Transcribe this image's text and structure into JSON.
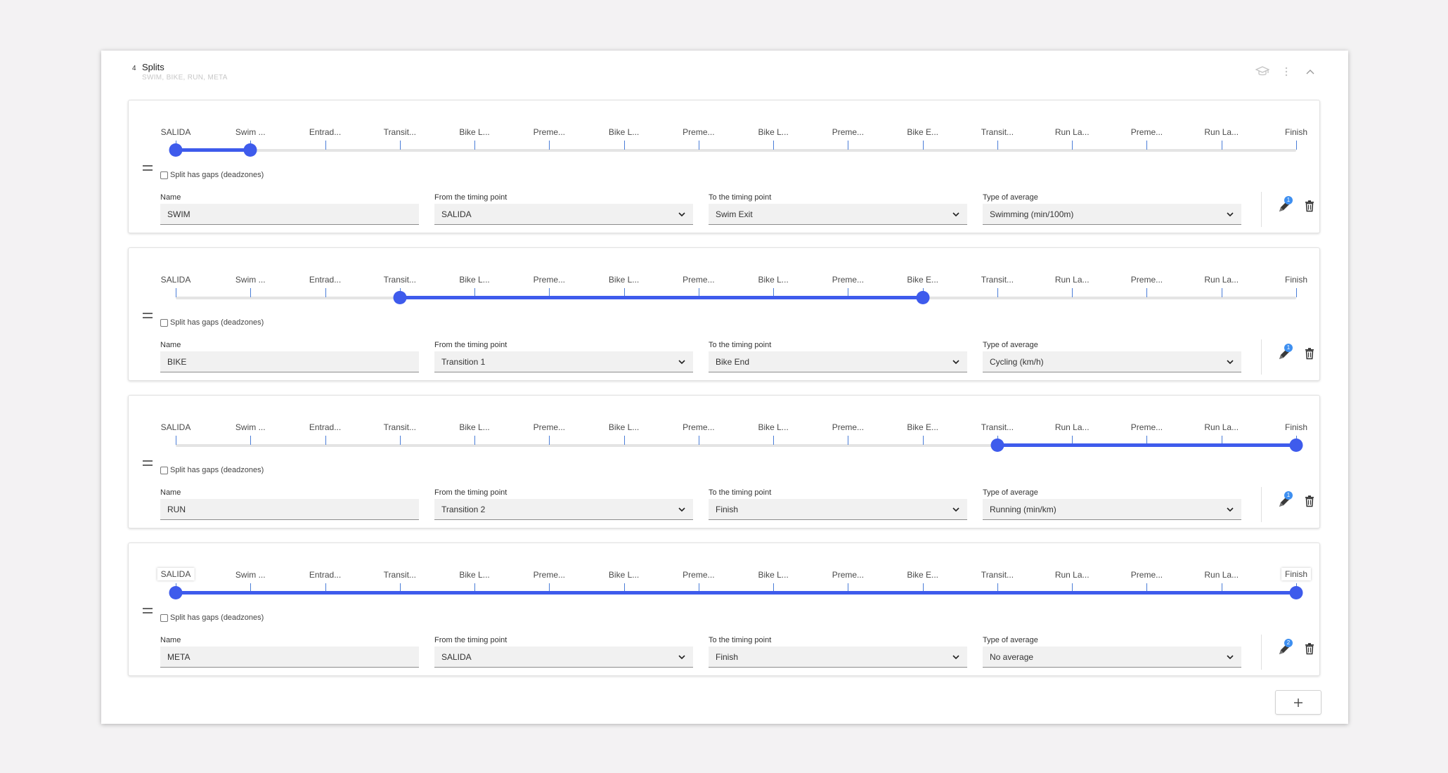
{
  "section": {
    "step_number": "4",
    "title": "Splits",
    "subtitle": "SWIM, BIKE, RUN, META"
  },
  "timing_points": [
    "SALIDA",
    "Swim ...",
    "Entrad...",
    "Transit...",
    "Bike L...",
    "Preme...",
    "Bike L...",
    "Preme...",
    "Bike L...",
    "Preme...",
    "Bike E...",
    "Transit...",
    "Run La...",
    "Preme...",
    "Run La...",
    "Finish"
  ],
  "labels": {
    "gaps": "Split has gaps (deadzones)",
    "name": "Name",
    "from": "From the timing point",
    "to": "To the timing point",
    "average": "Type of average"
  },
  "splits": [
    {
      "name": "SWIM",
      "from": "SALIDA",
      "to": "Swim Exit",
      "average": "Swimming (min/100m)",
      "badge": "1",
      "range": [
        0,
        1
      ],
      "boxed_labels": []
    },
    {
      "name": "BIKE",
      "from": "Transition 1",
      "to": "Bike End",
      "average": "Cycling (km/h)",
      "badge": "1",
      "range": [
        3,
        10
      ],
      "boxed_labels": []
    },
    {
      "name": "RUN",
      "from": "Transition 2",
      "to": "Finish",
      "average": "Running (min/km)",
      "badge": "1",
      "range": [
        11,
        15
      ],
      "boxed_labels": []
    },
    {
      "name": "META",
      "from": "SALIDA",
      "to": "Finish",
      "average": "No average",
      "badge": "2",
      "range": [
        0,
        15
      ],
      "boxed_labels": [
        0,
        15
      ]
    }
  ],
  "icons": {
    "header": [
      "graduation-cap-icon",
      "more-vertical-icon",
      "chevron-up-icon"
    ],
    "card": [
      "drag-handle-icon",
      "edit-pencil-icon",
      "trash-icon"
    ],
    "footer": [
      "plus-icon"
    ]
  },
  "colors": {
    "accent": "#3e5bec",
    "tick": "#4a7dd8",
    "badge": "#3e8ff0",
    "background": "#f3f2f3"
  }
}
